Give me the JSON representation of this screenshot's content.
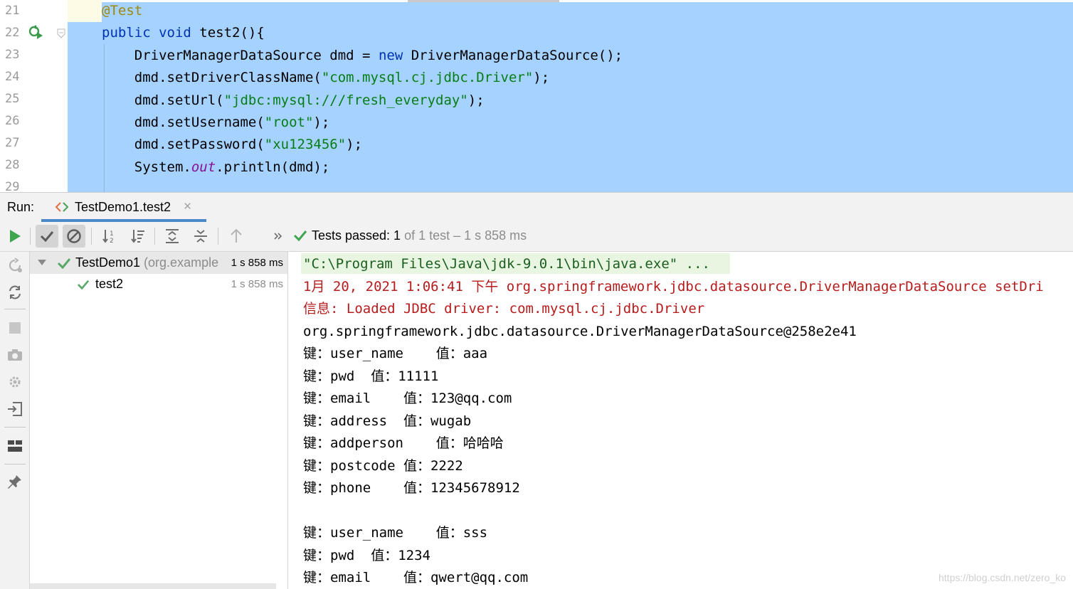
{
  "editor": {
    "line_numbers": [
      "21",
      "22",
      "23",
      "24",
      "25",
      "26",
      "27",
      "28",
      "29"
    ],
    "lines": [
      [
        {
          "t": "@Test",
          "c": "ann"
        }
      ],
      [
        {
          "t": "public ",
          "c": "kw"
        },
        {
          "t": "void ",
          "c": "kw"
        },
        {
          "t": "test2(){",
          "c": ""
        }
      ],
      [
        {
          "t": "    DriverManagerDataSource dmd = ",
          "c": ""
        },
        {
          "t": "new ",
          "c": "kw"
        },
        {
          "t": "DriverManagerDataSource();",
          "c": ""
        }
      ],
      [
        {
          "t": "    dmd.setDriverClassName(",
          "c": ""
        },
        {
          "t": "\"com.mysql.cj.jdbc.Driver\"",
          "c": "str"
        },
        {
          "t": ");",
          "c": ""
        }
      ],
      [
        {
          "t": "    dmd.setUrl(",
          "c": ""
        },
        {
          "t": "\"jdbc:mysql:///fresh_everyday\"",
          "c": "str"
        },
        {
          "t": ");",
          "c": ""
        }
      ],
      [
        {
          "t": "    dmd.setUsername(",
          "c": ""
        },
        {
          "t": "\"root\"",
          "c": "str"
        },
        {
          "t": ");",
          "c": ""
        }
      ],
      [
        {
          "t": "    dmd.setPassword(",
          "c": ""
        },
        {
          "t": "\"xu123456\"",
          "c": "str"
        },
        {
          "t": ");",
          "c": ""
        }
      ],
      [
        {
          "t": "    System.",
          "c": ""
        },
        {
          "t": "out",
          "c": "fld"
        },
        {
          "t": ".println(dmd);",
          "c": ""
        }
      ]
    ]
  },
  "run_panel": {
    "label": "Run:",
    "tab_label": "TestDemo1.test2",
    "tab_close": "×"
  },
  "status": {
    "strong": "Tests passed: 1",
    "muted": " of 1 test – 1 s 858 ms"
  },
  "tree": {
    "root": {
      "name": "TestDemo1",
      "package": " (org.example",
      "duration": "1 s 858 ms"
    },
    "child": {
      "name": "test2",
      "duration": "1 s 858 ms"
    }
  },
  "console": {
    "lines": [
      {
        "text": "\"C:\\Program Files\\Java\\jdk-9.0.1\\bin\\java.exe\" ...",
        "style": "cmdc"
      },
      {
        "text": "1月 20, 2021 1:06:41 下午 org.springframework.jdbc.datasource.DriverManagerDataSource setDri",
        "style": "red"
      },
      {
        "text": "信息: Loaded JDBC driver: com.mysql.cj.jdbc.Driver",
        "style": "red"
      },
      {
        "text": "org.springframework.jdbc.datasource.DriverManagerDataSource@258e2e41",
        "style": ""
      },
      {
        "text": "键：user_name    值：aaa",
        "style": ""
      },
      {
        "text": "键：pwd  值：11111",
        "style": ""
      },
      {
        "text": "键：email    值：123@qq.com",
        "style": ""
      },
      {
        "text": "键：address  值：wugab",
        "style": ""
      },
      {
        "text": "键：addperson    值：哈哈哈",
        "style": ""
      },
      {
        "text": "键：postcode 值：2222",
        "style": ""
      },
      {
        "text": "键：phone    值：12345678912",
        "style": ""
      },
      {
        "text": "",
        "style": ""
      },
      {
        "text": "键：user_name    值：sss",
        "style": ""
      },
      {
        "text": "键：pwd  值：1234",
        "style": ""
      },
      {
        "text": "键：email    值：qwert@qq.com",
        "style": ""
      }
    ]
  },
  "watermark": "https://blog.csdn.net/zero_ko",
  "colors": {
    "selection": "#a6d2ff",
    "accent": "#4a88c7",
    "pass": "#59a869"
  }
}
